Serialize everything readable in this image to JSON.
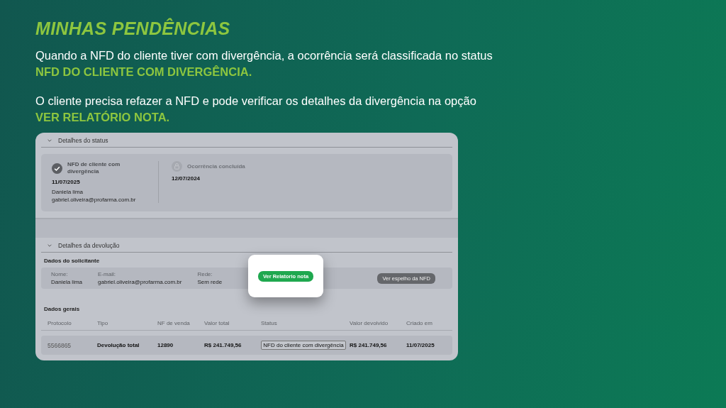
{
  "title": "MINHAS PENDÊNCIAS",
  "paragraphs": [
    {
      "text": "Quando a NFD do cliente tiver com  divergência, a ocorrência será classificada no status",
      "highlight": "NFD DO CLIENTE COM DIVERGÊNCIA."
    },
    {
      "text": "O cliente precisa refazer a NFD e pode verificar os detalhes da divergência na opção",
      "highlight": "VER RELATÓRIO NOTA."
    }
  ],
  "screenshot": {
    "status_section": {
      "title": "Detalhes do status",
      "expanded": true,
      "steps": [
        {
          "label": "NFD de cliente com divergência",
          "done": true,
          "date": "11/07/2025",
          "person": "Daniela lima",
          "email": "gabriel.oliveira@profarma.com.br"
        },
        {
          "label": "Ocorrência concluída",
          "done": false,
          "date": "12/07/2024"
        }
      ]
    },
    "return_section": {
      "title": "Detalhes da devolução",
      "expanded": true,
      "requester": {
        "title": "Dados do solicitante",
        "fields": [
          {
            "label": "Nome:",
            "value": "Daniela lima"
          },
          {
            "label": "E-mail:",
            "value": "gabriel.oliveira@profarma.com.br"
          },
          {
            "label": "Rede:",
            "value": "Sem rede"
          }
        ],
        "button": "Ver espelho da NFD"
      },
      "general": {
        "title": "Dados gerais",
        "columns": [
          "Protocolo",
          "Tipo",
          "NF de venda",
          "Valor total",
          "Status",
          "Valor devolvido",
          "Criado em"
        ],
        "rows": [
          [
            "5566865",
            "Devolução total",
            "12890",
            "R$ 241.749,56",
            "NFD do cliente com divergência",
            "R$ 241.749,56",
            "11/07/2025"
          ]
        ]
      }
    },
    "popup": {
      "button": "Ver Relatorio nota"
    }
  }
}
